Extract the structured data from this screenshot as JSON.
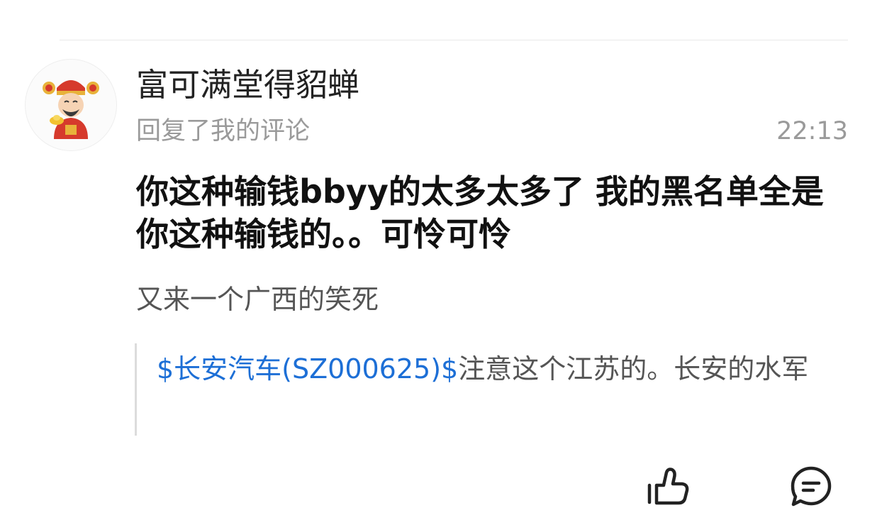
{
  "comment": {
    "username": "富可满堂得貂蝉",
    "action_text": "回复了我的评论",
    "time": "22:13",
    "reply_text": "你这种输钱bbyy的太多太多了 我的黑名单全是你这种输钱的。。可怜可怜",
    "my_comment": "又来一个广西的笑死",
    "quoted": {
      "stock_link": "$长安汽车(SZ000625)$",
      "text": "注意这个江苏的。长安的水军"
    }
  },
  "actions": {
    "like_icon": "thumbs-up-icon",
    "comment_icon": "comment-bubble-icon"
  },
  "colors": {
    "link": "#1d6fd6",
    "secondary_text": "#9a9a9a",
    "primary_text": "#111111"
  }
}
